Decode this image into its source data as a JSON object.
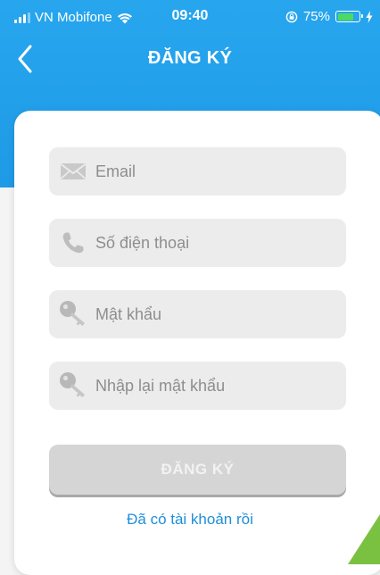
{
  "status_bar": {
    "carrier": "VN Mobifone",
    "time": "09:40",
    "battery_percent_label": "75%",
    "battery_level": 0.75
  },
  "header": {
    "title": "ĐĂNG KÝ"
  },
  "form": {
    "email_placeholder": "Email",
    "phone_placeholder": "Số điện thoại",
    "password_placeholder": "Mật khẩu",
    "confirm_password_placeholder": "Nhập lại mật khẩu",
    "submit_label": "ĐĂNG KÝ",
    "login_link_label": "Đã có tài khoản rồi"
  },
  "icons": {
    "back": "chevron-left-icon",
    "email": "envelope-icon",
    "phone": "phone-icon",
    "password": "key-icon",
    "confirm_password": "key-icon"
  },
  "colors": {
    "header_blue": "#1f9ae6",
    "link_blue": "#1f8fd8",
    "field_bg": "#ececec",
    "button_disabled": "#d5d5d5",
    "battery_green": "#4cd964",
    "corner_green": "#7ac142"
  }
}
